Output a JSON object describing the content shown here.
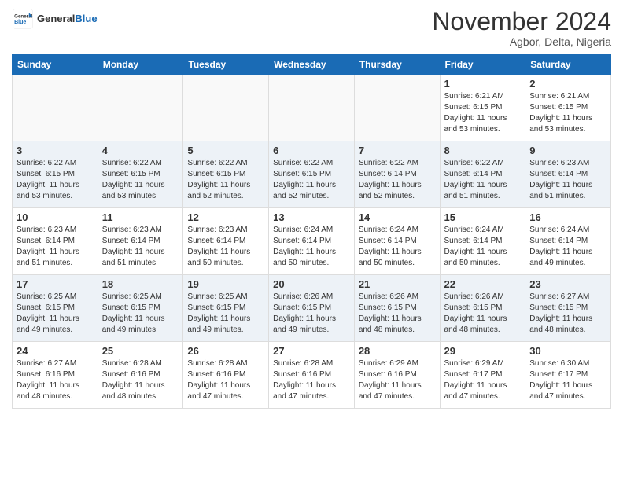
{
  "logo": {
    "general": "General",
    "blue": "Blue"
  },
  "header": {
    "month": "November 2024",
    "location": "Agbor, Delta, Nigeria"
  },
  "weekdays": [
    "Sunday",
    "Monday",
    "Tuesday",
    "Wednesday",
    "Thursday",
    "Friday",
    "Saturday"
  ],
  "weeks": [
    [
      {
        "day": "",
        "info": ""
      },
      {
        "day": "",
        "info": ""
      },
      {
        "day": "",
        "info": ""
      },
      {
        "day": "",
        "info": ""
      },
      {
        "day": "",
        "info": ""
      },
      {
        "day": "1",
        "info": "Sunrise: 6:21 AM\nSunset: 6:15 PM\nDaylight: 11 hours\nand 53 minutes."
      },
      {
        "day": "2",
        "info": "Sunrise: 6:21 AM\nSunset: 6:15 PM\nDaylight: 11 hours\nand 53 minutes."
      }
    ],
    [
      {
        "day": "3",
        "info": "Sunrise: 6:22 AM\nSunset: 6:15 PM\nDaylight: 11 hours\nand 53 minutes."
      },
      {
        "day": "4",
        "info": "Sunrise: 6:22 AM\nSunset: 6:15 PM\nDaylight: 11 hours\nand 53 minutes."
      },
      {
        "day": "5",
        "info": "Sunrise: 6:22 AM\nSunset: 6:15 PM\nDaylight: 11 hours\nand 52 minutes."
      },
      {
        "day": "6",
        "info": "Sunrise: 6:22 AM\nSunset: 6:15 PM\nDaylight: 11 hours\nand 52 minutes."
      },
      {
        "day": "7",
        "info": "Sunrise: 6:22 AM\nSunset: 6:14 PM\nDaylight: 11 hours\nand 52 minutes."
      },
      {
        "day": "8",
        "info": "Sunrise: 6:22 AM\nSunset: 6:14 PM\nDaylight: 11 hours\nand 51 minutes."
      },
      {
        "day": "9",
        "info": "Sunrise: 6:23 AM\nSunset: 6:14 PM\nDaylight: 11 hours\nand 51 minutes."
      }
    ],
    [
      {
        "day": "10",
        "info": "Sunrise: 6:23 AM\nSunset: 6:14 PM\nDaylight: 11 hours\nand 51 minutes."
      },
      {
        "day": "11",
        "info": "Sunrise: 6:23 AM\nSunset: 6:14 PM\nDaylight: 11 hours\nand 51 minutes."
      },
      {
        "day": "12",
        "info": "Sunrise: 6:23 AM\nSunset: 6:14 PM\nDaylight: 11 hours\nand 50 minutes."
      },
      {
        "day": "13",
        "info": "Sunrise: 6:24 AM\nSunset: 6:14 PM\nDaylight: 11 hours\nand 50 minutes."
      },
      {
        "day": "14",
        "info": "Sunrise: 6:24 AM\nSunset: 6:14 PM\nDaylight: 11 hours\nand 50 minutes."
      },
      {
        "day": "15",
        "info": "Sunrise: 6:24 AM\nSunset: 6:14 PM\nDaylight: 11 hours\nand 50 minutes."
      },
      {
        "day": "16",
        "info": "Sunrise: 6:24 AM\nSunset: 6:14 PM\nDaylight: 11 hours\nand 49 minutes."
      }
    ],
    [
      {
        "day": "17",
        "info": "Sunrise: 6:25 AM\nSunset: 6:15 PM\nDaylight: 11 hours\nand 49 minutes."
      },
      {
        "day": "18",
        "info": "Sunrise: 6:25 AM\nSunset: 6:15 PM\nDaylight: 11 hours\nand 49 minutes."
      },
      {
        "day": "19",
        "info": "Sunrise: 6:25 AM\nSunset: 6:15 PM\nDaylight: 11 hours\nand 49 minutes."
      },
      {
        "day": "20",
        "info": "Sunrise: 6:26 AM\nSunset: 6:15 PM\nDaylight: 11 hours\nand 49 minutes."
      },
      {
        "day": "21",
        "info": "Sunrise: 6:26 AM\nSunset: 6:15 PM\nDaylight: 11 hours\nand 48 minutes."
      },
      {
        "day": "22",
        "info": "Sunrise: 6:26 AM\nSunset: 6:15 PM\nDaylight: 11 hours\nand 48 minutes."
      },
      {
        "day": "23",
        "info": "Sunrise: 6:27 AM\nSunset: 6:15 PM\nDaylight: 11 hours\nand 48 minutes."
      }
    ],
    [
      {
        "day": "24",
        "info": "Sunrise: 6:27 AM\nSunset: 6:16 PM\nDaylight: 11 hours\nand 48 minutes."
      },
      {
        "day": "25",
        "info": "Sunrise: 6:28 AM\nSunset: 6:16 PM\nDaylight: 11 hours\nand 48 minutes."
      },
      {
        "day": "26",
        "info": "Sunrise: 6:28 AM\nSunset: 6:16 PM\nDaylight: 11 hours\nand 47 minutes."
      },
      {
        "day": "27",
        "info": "Sunrise: 6:28 AM\nSunset: 6:16 PM\nDaylight: 11 hours\nand 47 minutes."
      },
      {
        "day": "28",
        "info": "Sunrise: 6:29 AM\nSunset: 6:16 PM\nDaylight: 11 hours\nand 47 minutes."
      },
      {
        "day": "29",
        "info": "Sunrise: 6:29 AM\nSunset: 6:17 PM\nDaylight: 11 hours\nand 47 minutes."
      },
      {
        "day": "30",
        "info": "Sunrise: 6:30 AM\nSunset: 6:17 PM\nDaylight: 11 hours\nand 47 minutes."
      }
    ]
  ]
}
